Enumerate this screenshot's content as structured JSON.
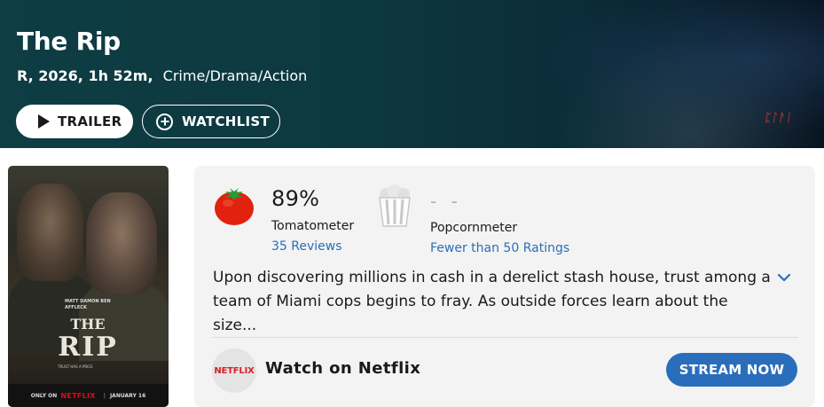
{
  "header": {
    "title": "The Rip",
    "rating_year_runtime": "R, 2026, 1h 52m,",
    "genres": "Crime/Drama/Action",
    "trailer_label": "TRAILER",
    "watchlist_label": "WATCHLIST"
  },
  "poster": {
    "names": "MATT DAMON  BEN AFFLECK",
    "title_the": "THE",
    "title_rip": "RIP",
    "tagline": "TRUST HAS A PRICE",
    "only_on": "ONLY ON",
    "network": "NETFLIX",
    "date": "JANUARY 16"
  },
  "scores": {
    "tomatometer_value": "89%",
    "tomatometer_label": "Tomatometer",
    "reviews_link": "35 Reviews",
    "popcornmeter_value": "- -",
    "popcornmeter_label": "Popcornmeter",
    "ratings_link": "Fewer than 50 Ratings"
  },
  "synopsis": "Upon discovering millions in cash in a derelict stash house, trust among a team of Miami cops begins to fray. As outside forces learn about the size...",
  "streaming": {
    "logo_text": "NETFLIX",
    "watch_label": "Watch on Netflix",
    "stream_button": "STREAM NOW"
  },
  "colors": {
    "accent_blue": "#2a6ebb",
    "netflix_red": "#d81f26",
    "tomato_red": "#e0220f",
    "hero_teal": "#0e3d44"
  },
  "icons": {
    "trailer": "play-icon",
    "watchlist": "plus-circle-icon",
    "tomatometer": "tomato-icon",
    "popcornmeter": "popcorn-bucket-icon",
    "expand": "chevron-down-icon"
  }
}
